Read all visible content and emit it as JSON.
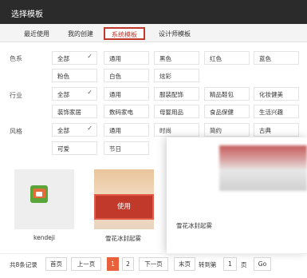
{
  "title": "选择模板",
  "tabs": [
    "最近使用",
    "我的创建",
    "系统模板",
    "设计师模板"
  ],
  "filters": {
    "color": {
      "label": "色系",
      "items": [
        "全部",
        "通用",
        "黑色",
        "红色",
        "蓝色",
        "粉色",
        "白色",
        "炫彩"
      ]
    },
    "industry": {
      "label": "行业",
      "items": [
        "全部",
        "通用",
        "服装配饰",
        "精品鞋包",
        "化妆健美",
        "装饰家居",
        "数码家电",
        "母婴用品",
        "食品保健",
        "生活兴趣"
      ]
    },
    "style": {
      "label": "风格",
      "items": [
        "全部",
        "通用",
        "时尚",
        "简约",
        "古典",
        "可爱",
        "节日"
      ]
    }
  },
  "cards": [
    {
      "label": "kendeji"
    },
    {
      "label": "雪花冰封起雾",
      "use_label": "使用"
    }
  ],
  "preview": {
    "label": "雪花冰封起雾"
  },
  "pagination": {
    "total_text": "共8条记录",
    "first": "首页",
    "prev": "上一页",
    "pages": [
      "1",
      "2"
    ],
    "next": "下一页",
    "last": "末页",
    "goto_prefix": "转到第",
    "goto_value": "1",
    "goto_suffix": "页",
    "go": "Go"
  },
  "colors": {
    "accent": "#c0392b",
    "current_page": "#e8603c",
    "titlebar": "#2b2b2b"
  },
  "icons": {
    "selected_check": "check-icon",
    "store": "store-icon"
  }
}
